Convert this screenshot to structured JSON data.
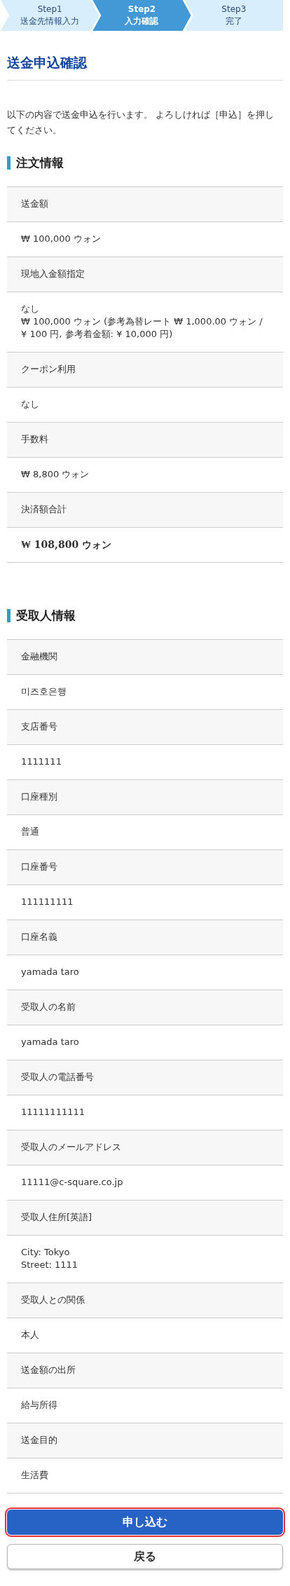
{
  "steps": [
    {
      "step": "Step1",
      "name": "送金先情報入力",
      "selected": false
    },
    {
      "step": "Step2",
      "name": "入力確認",
      "selected": true
    },
    {
      "step": "Step3",
      "name": "完了",
      "selected": false
    }
  ],
  "title": "送金申込確認",
  "intro": "以下の内容で送金申込を行います。 よろしければ［申込］を押してください。",
  "sections": [
    {
      "heading": "注文情報",
      "rows": [
        {
          "label": "送金額",
          "value": "₩ 100,000 ウォン",
          "emphasis": false
        },
        {
          "label": "現地入金額指定",
          "value": "なし\n₩ 100,000 ウォン (参考為替レート ₩ 1,000.00 ウォン / ¥ 100 円, 参考着金額: ¥ 10,000 円)",
          "emphasis": false
        },
        {
          "label": "クーポン利用",
          "value": "なし",
          "emphasis": false
        },
        {
          "label": "手数料",
          "value": "₩ 8,800 ウォン",
          "emphasis": false
        },
        {
          "label": "決済額合計",
          "value": "₩ 108,800 ウォン",
          "emphasis": true
        }
      ]
    },
    {
      "heading": "受取人情報",
      "rows": [
        {
          "label": "金融機関",
          "value": "미즈호은행",
          "emphasis": false
        },
        {
          "label": "支店番号",
          "value": "1111111",
          "emphasis": false
        },
        {
          "label": "口座種別",
          "value": "普通",
          "emphasis": false
        },
        {
          "label": "口座番号",
          "value": "111111111",
          "emphasis": false
        },
        {
          "label": "口座名義",
          "value": "yamada taro",
          "emphasis": false
        },
        {
          "label": "受取人の名前",
          "value": "yamada taro",
          "emphasis": false
        },
        {
          "label": "受取人の電話番号",
          "value": "11111111111",
          "emphasis": false
        },
        {
          "label": "受取人のメールアドレス",
          "value": "11111@c-square.co.jp",
          "emphasis": false
        },
        {
          "label": "受取人住所[英語]",
          "value": "City: Tokyo\nStreet: 1111",
          "emphasis": false
        },
        {
          "label": "受取人との関係",
          "value": "本人",
          "emphasis": false
        },
        {
          "label": "送金額の出所",
          "value": "給与所得",
          "emphasis": false
        },
        {
          "label": "送金目的",
          "value": "生活費",
          "emphasis": false
        }
      ]
    }
  ],
  "buttons": [
    {
      "label": "申し込む",
      "kind": "primary",
      "focused": true
    },
    {
      "label": "戻る",
      "kind": "secondary",
      "focused": false
    }
  ]
}
